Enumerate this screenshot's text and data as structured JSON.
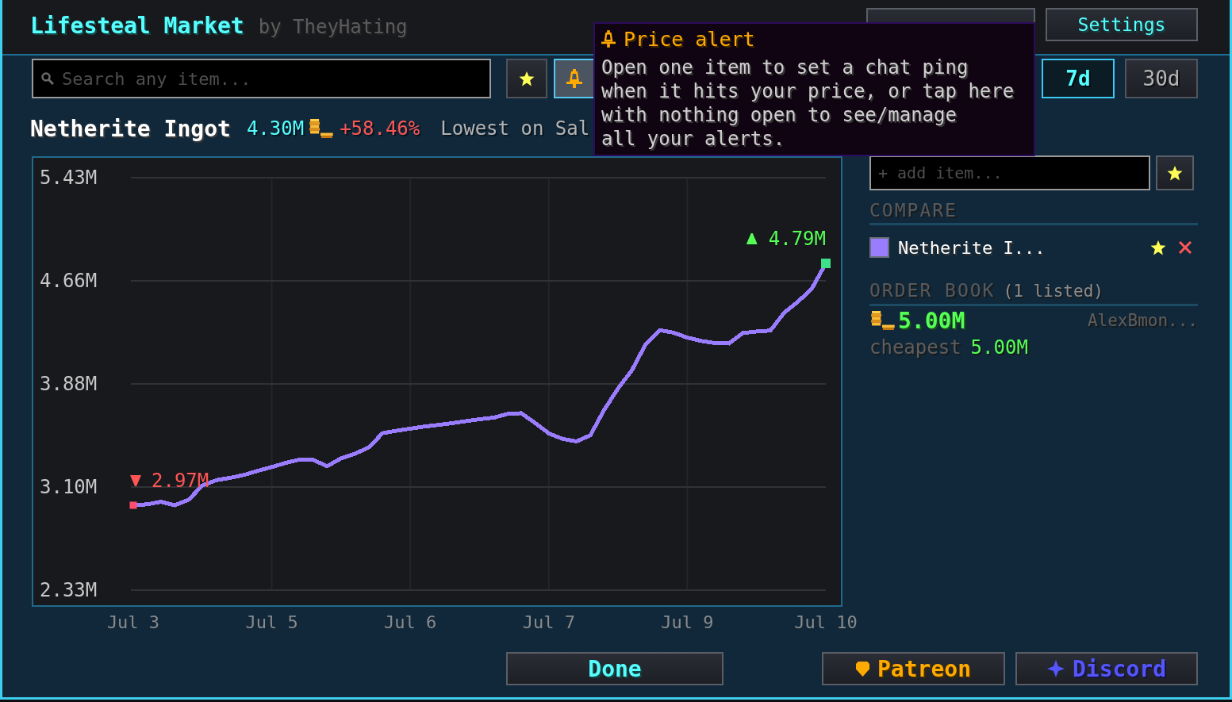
{
  "header": {
    "title": "Lifesteal Market",
    "byline": "by TheyHating",
    "buttons": [
      {
        "kind": "covered"
      },
      {
        "kind": "text",
        "label": "Settings"
      }
    ]
  },
  "toolbar": {
    "search": {
      "placeholder": "Search any item..."
    },
    "buttons": [
      {
        "kind": "star",
        "highlighted": false
      },
      {
        "kind": "alert",
        "highlighted": true
      }
    ],
    "ranges": [
      {
        "label": "7d",
        "selected": true
      },
      {
        "label": "30d",
        "selected": false
      }
    ]
  },
  "item": {
    "name": "Netherite Ingot",
    "price": "4.30M",
    "change": "+58.46%",
    "stats": "Lowest on Sal",
    "chart_data": {
      "type": "line",
      "grid": true,
      "categories": [
        "Jul 3",
        null,
        null,
        null,
        null,
        null,
        null,
        null,
        null,
        null,
        "Jul 5",
        null,
        null,
        null,
        null,
        null,
        null,
        null,
        null,
        null,
        "Jul 6",
        null,
        null,
        null,
        null,
        null,
        null,
        null,
        null,
        null,
        "Jul 7",
        null,
        null,
        null,
        null,
        null,
        null,
        null,
        null,
        null,
        "Jul 9",
        null,
        null,
        null,
        null,
        null,
        null,
        null,
        null,
        null,
        "Jul 10"
      ],
      "series": [
        {
          "color": "#9a7cff",
          "values": [
            2.968,
            2.975,
            2.994,
            2.968,
            3.01,
            3.117,
            3.157,
            3.174,
            3.196,
            3.227,
            3.255,
            3.286,
            3.311,
            3.308,
            3.262,
            3.32,
            3.355,
            3.403,
            3.51,
            3.528,
            3.544,
            3.559,
            3.571,
            3.585,
            3.6,
            3.615,
            3.626,
            3.654,
            3.66,
            3.588,
            3.508,
            3.467,
            3.448,
            3.494,
            3.685,
            3.846,
            3.983,
            4.18,
            4.285,
            4.265,
            4.228,
            4.203,
            4.187,
            4.184,
            4.262,
            4.274,
            4.281,
            4.416,
            4.499,
            4.598,
            4.786
          ]
        }
      ],
      "ylim": [
        2.33,
        5.43
      ],
      "yticks": [
        {
          "value": 5.43,
          "label": "5.43M"
        },
        {
          "value": 4.655,
          "label": "4.66M"
        },
        {
          "value": 3.88,
          "label": "3.88M"
        },
        {
          "value": 3.105,
          "label": "3.10M"
        },
        {
          "value": 2.33,
          "label": "2.33M"
        }
      ],
      "annotations": [
        {
          "x": "Jul 10",
          "y": 4.786,
          "text": "4.79M"
        },
        {
          "x": "Jul 3",
          "y": 2.968,
          "text": "2.97M"
        }
      ]
    }
  },
  "compare": {
    "add_field": {
      "placeholder": "+ add item..."
    },
    "heading": "COMPARE",
    "items": [
      {
        "name": "Netherite I...",
        "color": "#9a7cff"
      }
    ]
  },
  "order_book": {
    "title": "ORDER BOOK",
    "count": "(1 listed)",
    "orders": [
      {
        "price": "5.00M",
        "seller": "AlexBmon..."
      }
    ],
    "cheapest_label": "cheapest",
    "cheapest_price": "5.00M"
  },
  "footer": {
    "done": {
      "label": "Done"
    },
    "links": [
      {
        "kind": "patreon",
        "label": "Patreon"
      },
      {
        "kind": "discord",
        "label": "Discord"
      }
    ]
  },
  "tooltip": {
    "title": "Price alert",
    "lines": [
      "Open one item to set a chat ping",
      "when it hits your price, or tap here",
      "with nothing open to see/manage",
      "all your alerts."
    ]
  }
}
